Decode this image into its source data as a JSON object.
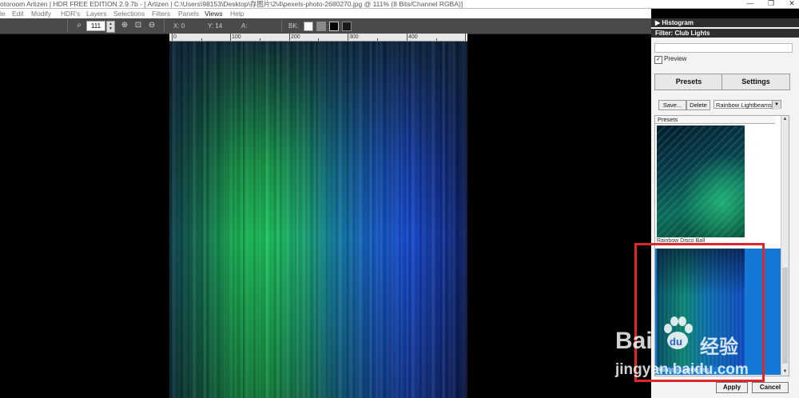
{
  "title_bar": {
    "title": "otoroom Artizen | HDR FREE EDITION 2.9.7b - [ Artizen | C:\\Users\\98153\\Desktop\\存图片\\2\\4\\pexels-photo-2680270.jpg @ 111% (8 Bits/Channel RGBA)]",
    "minimize": "—",
    "maximize": "❐",
    "close": "✕"
  },
  "menu": [
    "le",
    "Edit",
    "Modify",
    "HDR's",
    "Layers",
    "Selections",
    "Filters",
    "Panels",
    "Views",
    "Help"
  ],
  "toolbar": {
    "zoom_value": "111",
    "x_label": "X: 0",
    "y_label": "Y: 14",
    "a_label": "A:",
    "bk_label": "BK:",
    "bk_colors": [
      "#ffffff",
      "#8a8a8a",
      "#000000",
      "#1a1a1a"
    ]
  },
  "ruler": {
    "labels": [
      "0",
      "100",
      "200",
      "300",
      "400"
    ]
  },
  "panel": {
    "histogram_header": "Histogram",
    "filter_header": "Filter: Club Lights",
    "preview_label": "Preview",
    "preview_checked": "✓",
    "presets_button": "Presets",
    "settings_button": "Settings",
    "save_button": "Save...",
    "delete_button": "Delete",
    "preset_select": "Rainbow Lightbeams",
    "list_header": "Presets",
    "items": [
      {
        "label": "Rainbow Disco Ball",
        "selected": false
      },
      {
        "label": "Rainbow Lightbeams",
        "selected": true
      }
    ],
    "apply_button": "Apply",
    "cancel_button": "Cancel"
  },
  "watermark": {
    "brand": "Bai",
    "du": "du",
    "cn": "经验",
    "url": "jingyan.baidu.com"
  },
  "colors": {
    "accent_selection": "#1478d6",
    "highlight_box": "#e0252b",
    "toolbar_bg": "#4a4a4a",
    "panel_header_bg": "#2f2f2f"
  }
}
